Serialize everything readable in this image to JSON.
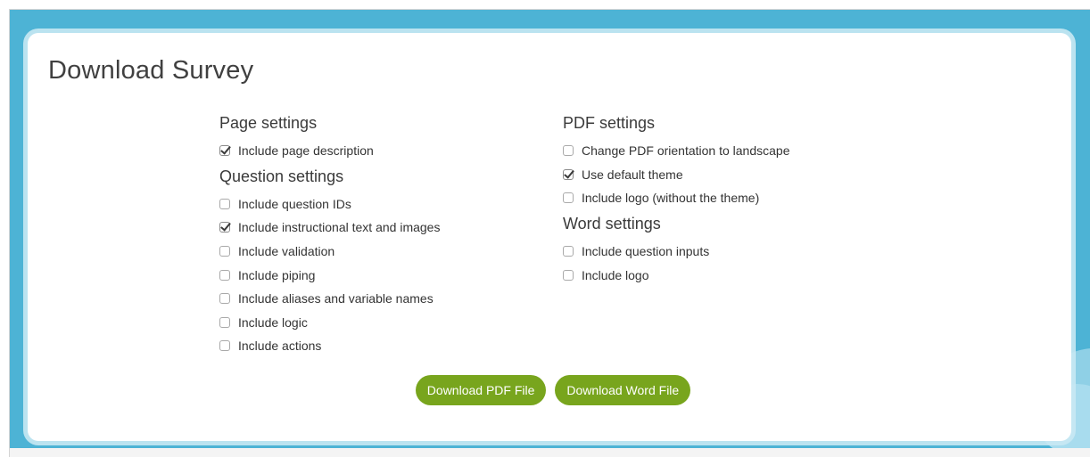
{
  "dialog": {
    "title": "Download Survey"
  },
  "page_settings": {
    "heading": "Page settings",
    "options": [
      {
        "label": "Include page description",
        "checked": true
      }
    ]
  },
  "question_settings": {
    "heading": "Question settings",
    "options": [
      {
        "label": "Include question IDs",
        "checked": false
      },
      {
        "label": "Include instructional text and images",
        "checked": true
      },
      {
        "label": "Include validation",
        "checked": false
      },
      {
        "label": "Include piping",
        "checked": false
      },
      {
        "label": "Include aliases and variable names",
        "checked": false
      },
      {
        "label": "Include logic",
        "checked": false
      },
      {
        "label": "Include actions",
        "checked": false
      }
    ]
  },
  "pdf_settings": {
    "heading": "PDF settings",
    "options": [
      {
        "label": "Change PDF orientation to landscape",
        "checked": false
      },
      {
        "label": "Use default theme",
        "checked": true
      },
      {
        "label": "Include logo (without the theme)",
        "checked": false
      }
    ]
  },
  "word_settings": {
    "heading": "Word settings",
    "options": [
      {
        "label": "Include question inputs",
        "checked": false
      },
      {
        "label": "Include logo",
        "checked": false
      }
    ]
  },
  "buttons": {
    "download_pdf": "Download PDF File",
    "download_word": "Download Word File"
  },
  "colors": {
    "background": "#4db3d5",
    "button": "#78a51d"
  }
}
